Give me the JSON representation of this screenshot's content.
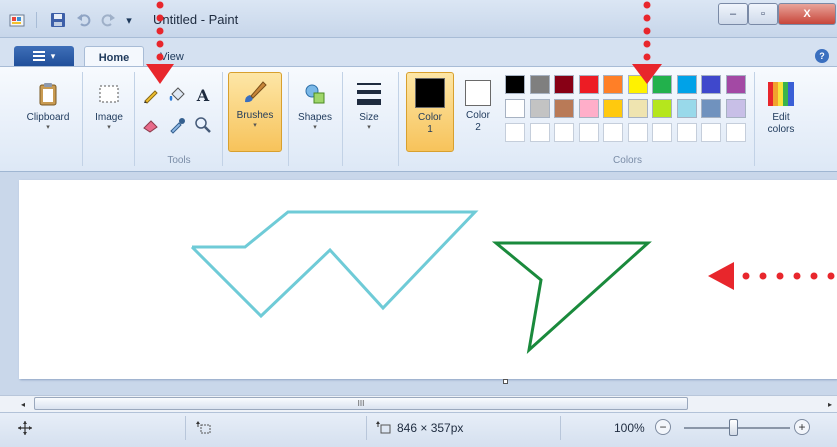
{
  "window": {
    "title": "Untitled - Paint",
    "minimize_glyph": "‒",
    "maximize_glyph": "▫",
    "close_glyph": "X"
  },
  "quick_access": {
    "app_icon": "paint-app-icon",
    "save_icon": "save-icon",
    "undo_icon": "undo-icon",
    "redo_icon": "redo-icon",
    "customize_glyph": "▾"
  },
  "ribbon": {
    "app_menu_glyph": "▾",
    "tabs": [
      {
        "label": "Home",
        "active": true
      },
      {
        "label": "View",
        "active": false
      }
    ],
    "help_glyph": "?",
    "groups": {
      "clipboard": {
        "label": "Clipboard"
      },
      "image": {
        "label": "Image"
      },
      "tools": {
        "label": "Tools",
        "text_tool_glyph": "A",
        "items": [
          "pencil-icon",
          "fill-icon",
          "text-icon",
          "eraser-icon",
          "color-picker-icon",
          "magnifier-icon"
        ]
      },
      "brushes": {
        "label": "Brushes"
      },
      "shapes": {
        "label": "Shapes"
      },
      "size": {
        "label": "Size"
      },
      "color1": {
        "label_line1": "Color",
        "label_line2": "1",
        "color": "#000000"
      },
      "color2": {
        "label_line1": "Color",
        "label_line2": "2",
        "color": "#ffffff"
      },
      "colors": {
        "label": "Colors",
        "row1": [
          "#000000",
          "#7f7f7f",
          "#880015",
          "#ed1c24",
          "#ff7f27",
          "#fff200",
          "#22b14c",
          "#00a2e8",
          "#3f48cc",
          "#a349a4"
        ],
        "row2": [
          "#ffffff",
          "#c3c3c3",
          "#b97a57",
          "#ffaec9",
          "#ffc90e",
          "#efe4b0",
          "#b5e61d",
          "#99d9ea",
          "#7092be",
          "#c8bfe7"
        ],
        "row3": [
          "",
          "",
          "",
          "",
          "",
          "",
          "",
          "",
          "",
          ""
        ]
      },
      "edit_colors": {
        "label_line1": "Edit",
        "label_line2": "colors"
      }
    }
  },
  "canvas": {
    "background": "#ffffff",
    "shapes": [
      {
        "name": "cyan-polyline",
        "color": "#6fcbd7"
      },
      {
        "name": "green-triangle",
        "color": "#1a8a3c"
      }
    ]
  },
  "scrollbar": {
    "left_glyph": "◂",
    "right_glyph": "▸",
    "grip_glyph": "III"
  },
  "status": {
    "move_icon": "move-cursor-icon",
    "selection_icon": "selection-size-icon",
    "canvas_size_icon": "canvas-size-icon",
    "canvas_size": "846 × 357px",
    "zoom": "100%",
    "zoom_out_glyph": "−",
    "zoom_in_glyph": "+"
  },
  "annotations": {
    "arrow_color": "#e8262c"
  }
}
